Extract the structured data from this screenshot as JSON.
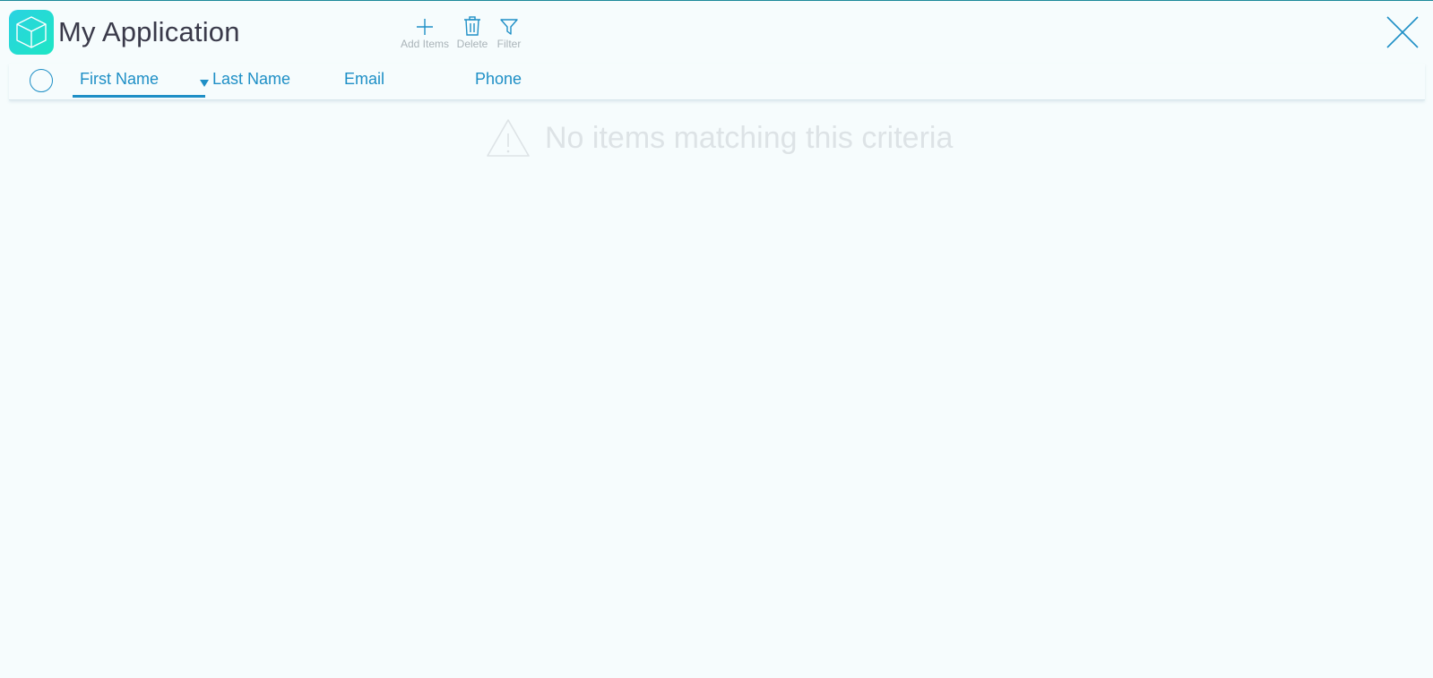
{
  "app": {
    "title": "My Application",
    "accent_color": "#1e8fc6",
    "logo_gradient": [
      "#2ad2e2",
      "#1ee6c4"
    ]
  },
  "toolbar": {
    "items": [
      {
        "label": "Add Items",
        "icon": "plus-icon"
      },
      {
        "label": "Delete",
        "icon": "trash-icon"
      },
      {
        "label": "Filter",
        "icon": "filter-icon"
      }
    ]
  },
  "columns": [
    {
      "label": "First Name",
      "active": true,
      "sort": "descending"
    },
    {
      "label": "Last Name"
    },
    {
      "label": "Email"
    },
    {
      "label": "Phone"
    }
  ],
  "empty_state": {
    "message": "No items matching this criteria",
    "icon": "warning-icon"
  }
}
